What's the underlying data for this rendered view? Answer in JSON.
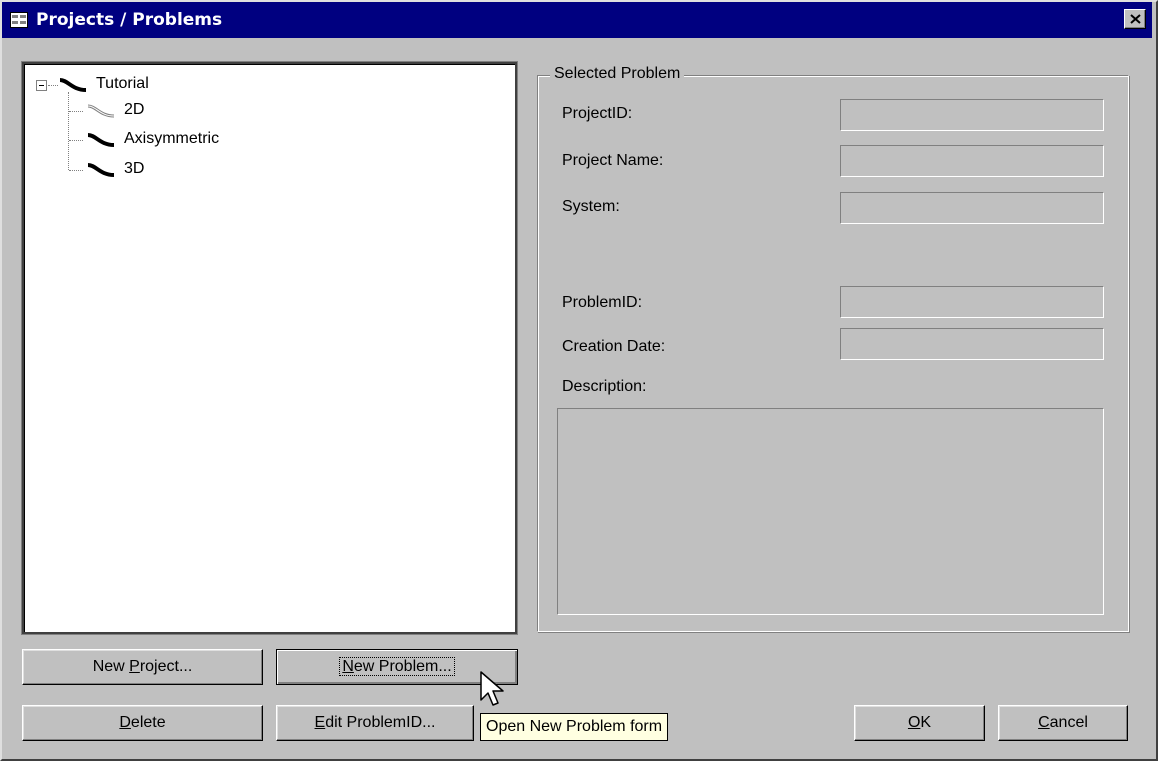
{
  "window": {
    "title": "Projects / Problems",
    "title_icon": "form-icon",
    "close_icon": "close-icon"
  },
  "tree": {
    "root": {
      "label": "Tutorial",
      "expanded": true,
      "icon": "curve-icon"
    },
    "children": [
      {
        "label": "2D",
        "icon": "curve-outline-icon"
      },
      {
        "label": "Axisymmetric",
        "icon": "curve-icon"
      },
      {
        "label": "3D",
        "icon": "curve-icon"
      }
    ]
  },
  "selected_problem": {
    "legend": "Selected Problem",
    "project_id_label": "ProjectID:",
    "project_name_label": "Project Name:",
    "system_label": "System:",
    "problem_id_label": "ProblemID:",
    "creation_date_label": "Creation Date:",
    "description_label": "Description:",
    "project_id_value": "",
    "project_name_value": "",
    "system_value": "",
    "problem_id_value": "",
    "creation_date_value": "",
    "description_value": ""
  },
  "buttons": {
    "new_project": {
      "pre": "New ",
      "key": "P",
      "post": "roject..."
    },
    "new_problem": {
      "pre": "",
      "key": "N",
      "post": "ew Problem..."
    },
    "delete": {
      "pre": "",
      "key": "D",
      "post": "elete"
    },
    "edit_problem_id": {
      "pre": "",
      "key": "E",
      "post": "dit ProblemID..."
    },
    "ok": {
      "pre": "",
      "key": "O",
      "post": "K"
    },
    "cancel": {
      "pre": "",
      "key": "C",
      "post": "ancel"
    }
  },
  "tooltip": {
    "text": "Open New Problem form"
  }
}
